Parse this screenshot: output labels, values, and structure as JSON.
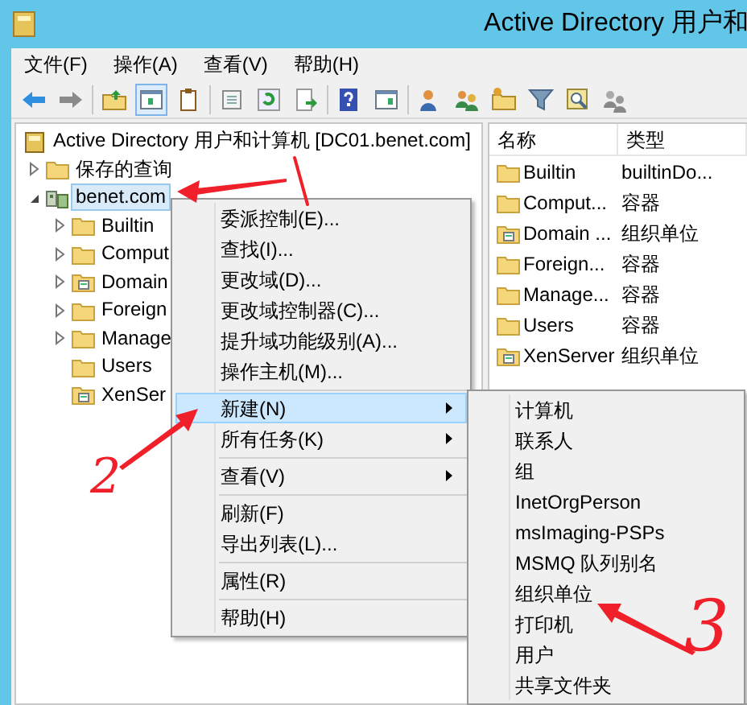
{
  "window": {
    "title": "Active Directory 用户和"
  },
  "menu_bar": [
    "文件(F)",
    "操作(A)",
    "查看(V)",
    "帮助(H)"
  ],
  "toolbar_buttons": [
    {
      "pressed": false
    },
    {
      "pressed": false
    },
    {
      "pressed": false
    },
    {
      "pressed": true
    },
    {
      "pressed": false
    },
    {
      "pressed": false
    },
    {
      "pressed": false
    },
    {
      "pressed": false
    },
    {
      "pressed": false
    },
    {
      "pressed": false
    },
    {
      "pressed": false
    },
    {
      "pressed": false
    },
    {
      "pressed": false
    },
    {
      "pressed": false
    },
    {
      "pressed": false
    },
    {
      "pressed": false
    }
  ],
  "tree": {
    "label": "Active Directory 用户和计算机 [DC01.benet.com]",
    "kind": "root",
    "selected": false,
    "children": [
      {
        "label": "保存的查询",
        "kind": "folder",
        "expanded": false,
        "selected": false
      },
      {
        "label": "benet.com",
        "kind": "domain",
        "expanded": true,
        "selected": true,
        "children": [
          {
            "label": "Builtin",
            "kind": "folder",
            "expanded": false,
            "selected": false
          },
          {
            "label": "Comput",
            "kind": "folder",
            "expanded": false,
            "selected": false
          },
          {
            "label": "Domain",
            "kind": "ou",
            "expanded": false,
            "selected": false
          },
          {
            "label": "Foreign",
            "kind": "folder",
            "expanded": false,
            "selected": false
          },
          {
            "label": "Manage",
            "kind": "folder",
            "expanded": false,
            "selected": false
          },
          {
            "label": "Users",
            "kind": "folder",
            "selected": false
          },
          {
            "label": "XenSer",
            "kind": "ou",
            "selected": false
          }
        ]
      }
    ]
  },
  "list": {
    "columns": [
      "名称",
      "类型"
    ],
    "rows": [
      {
        "name": "Builtin",
        "type": "builtinDo...",
        "kind": "folder"
      },
      {
        "name": "Comput...",
        "type": "容器",
        "kind": "folder"
      },
      {
        "name": "Domain ...",
        "type": "组织单位",
        "kind": "ou"
      },
      {
        "name": "Foreign...",
        "type": "容器",
        "kind": "folder"
      },
      {
        "name": "Manage...",
        "type": "容器",
        "kind": "folder"
      },
      {
        "name": "Users",
        "type": "容器",
        "kind": "folder"
      },
      {
        "name": "XenServer",
        "type": "组织单位",
        "kind": "ou"
      }
    ]
  },
  "context_menu": [
    {
      "kind": "item",
      "label": "委派控制(E)...",
      "selected": false,
      "submenu": false
    },
    {
      "kind": "item",
      "label": "查找(I)...",
      "selected": false,
      "submenu": false
    },
    {
      "kind": "item",
      "label": "更改域(D)...",
      "selected": false,
      "submenu": false
    },
    {
      "kind": "item",
      "label": "更改域控制器(C)...",
      "selected": false,
      "submenu": false
    },
    {
      "kind": "item",
      "label": "提升域功能级别(A)...",
      "selected": false,
      "submenu": false
    },
    {
      "kind": "item",
      "label": "操作主机(M)...",
      "selected": false,
      "submenu": false
    },
    {
      "kind": "separator"
    },
    {
      "kind": "item",
      "label": "新建(N)",
      "selected": true,
      "submenu": true
    },
    {
      "kind": "item",
      "label": "所有任务(K)",
      "selected": false,
      "submenu": true
    },
    {
      "kind": "separator"
    },
    {
      "kind": "item",
      "label": "查看(V)",
      "selected": false,
      "submenu": true
    },
    {
      "kind": "separator"
    },
    {
      "kind": "item",
      "label": "刷新(F)",
      "selected": false,
      "submenu": false
    },
    {
      "kind": "item",
      "label": "导出列表(L)...",
      "selected": false,
      "submenu": false
    },
    {
      "kind": "separator"
    },
    {
      "kind": "item",
      "label": "属性(R)",
      "selected": false,
      "submenu": false
    },
    {
      "kind": "separator"
    },
    {
      "kind": "item",
      "label": "帮助(H)",
      "selected": false,
      "submenu": false
    }
  ],
  "submenu": [
    {
      "label": "计算机",
      "selected": false
    },
    {
      "label": "联系人",
      "selected": false
    },
    {
      "label": "组",
      "selected": false
    },
    {
      "label": "InetOrgPerson",
      "selected": false
    },
    {
      "label": "msImaging-PSPs",
      "selected": false
    },
    {
      "label": "MSMQ 队列别名",
      "selected": false
    },
    {
      "label": "组织单位",
      "selected": false
    },
    {
      "label": "打印机",
      "selected": false
    },
    {
      "label": "用户",
      "selected": false
    },
    {
      "label": "共享文件夹",
      "selected": false
    }
  ],
  "annotations": [
    {
      "text": "2"
    },
    {
      "text": "3"
    }
  ]
}
